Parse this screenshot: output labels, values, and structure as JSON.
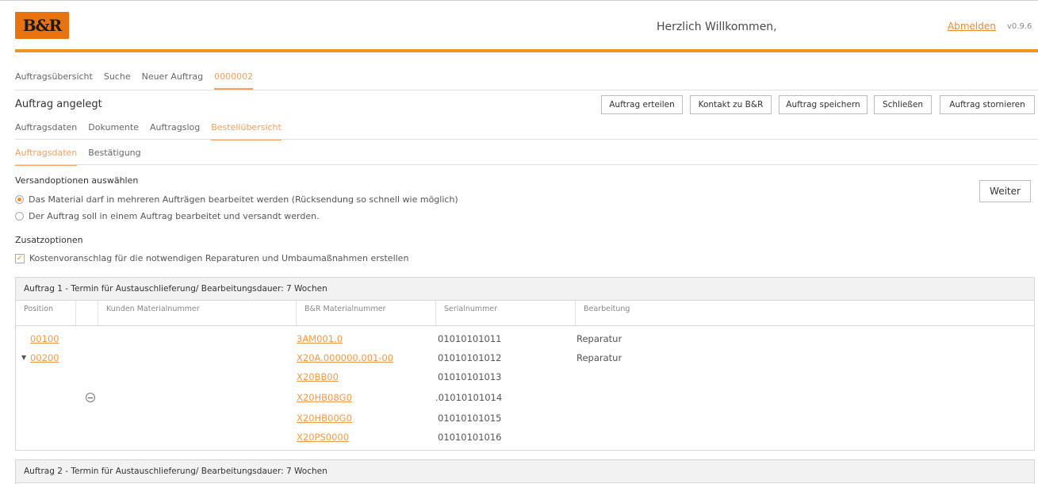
{
  "header": {
    "logo_text": "B&R",
    "welcome": "Herzlich Willkommen,",
    "logout": "Abmelden",
    "version": "v0.9.6"
  },
  "nav_main": [
    "Auftragsübersicht",
    "Suche",
    "Neuer Auftrag",
    "0000002"
  ],
  "status": "Auftrag angelegt",
  "actions": {
    "create": "Auftrag erteilen",
    "contact": "Kontakt zu B&R",
    "save": "Auftrag speichern",
    "close": "Schließen",
    "cancel": "Auftrag stornieren"
  },
  "nav_sub": [
    "Auftragsdaten",
    "Dokumente",
    "Auftragslog",
    "Bestellübersicht"
  ],
  "nav_sub2": [
    "Auftragsdaten",
    "Bestätigung"
  ],
  "shipping": {
    "title": "Versandoptionen auswählen",
    "option1": "Das Material darf in mehreren Aufträgen bearbeitet werden (Rücksendung so schnell wie möglich)",
    "option2": "Der Auftrag soll in einem Auftrag bearbeitet und versandt werden.",
    "next": "Weiter"
  },
  "extra": {
    "title": "Zusatzoptionen",
    "option1": "Kostenvoranschlag für die notwendigen Reparaturen und Umbaumaßnahmen erstellen"
  },
  "orders": [
    {
      "title": "Auftrag 1 - Termin für Austauschlieferung/ Bearbeitungsdauer: 7 Wochen",
      "columns": {
        "position": "Position",
        "customer_material": "Kunden Materialnummer",
        "br_material": "B&R Materialnummer",
        "serial": "Serialnummer",
        "processing": "Bearbeitung"
      },
      "rows": [
        {
          "position": "00100",
          "material": "3AM001.0",
          "serial": "01010101011",
          "processing": "Reparatur"
        },
        {
          "position": "00200",
          "material": "X20A.000000.001-00",
          "serial": "01010101012",
          "processing": "Reparatur"
        },
        {
          "position": "",
          "material": "X20BB00",
          "serial": "01010101013",
          "processing": ""
        },
        {
          "position": "",
          "material": "X20HB08G0",
          "serial": ".01010101014",
          "processing": ""
        },
        {
          "position": "",
          "material": "X20HB00G0",
          "serial": "01010101015",
          "processing": ""
        },
        {
          "position": "",
          "material": "X20PS0000",
          "serial": "01010101016",
          "processing": ""
        }
      ]
    },
    {
      "title": "Auftrag 2 - Termin für Austauschlieferung/ Bearbeitungsdauer: 7 Wochen"
    }
  ],
  "icons": {
    "logo": "br-logo",
    "expand": "triangle-down-icon",
    "collapse": "minus-circle-icon"
  },
  "colors": {
    "accent": "#f39224",
    "link": "#f39a4a"
  }
}
